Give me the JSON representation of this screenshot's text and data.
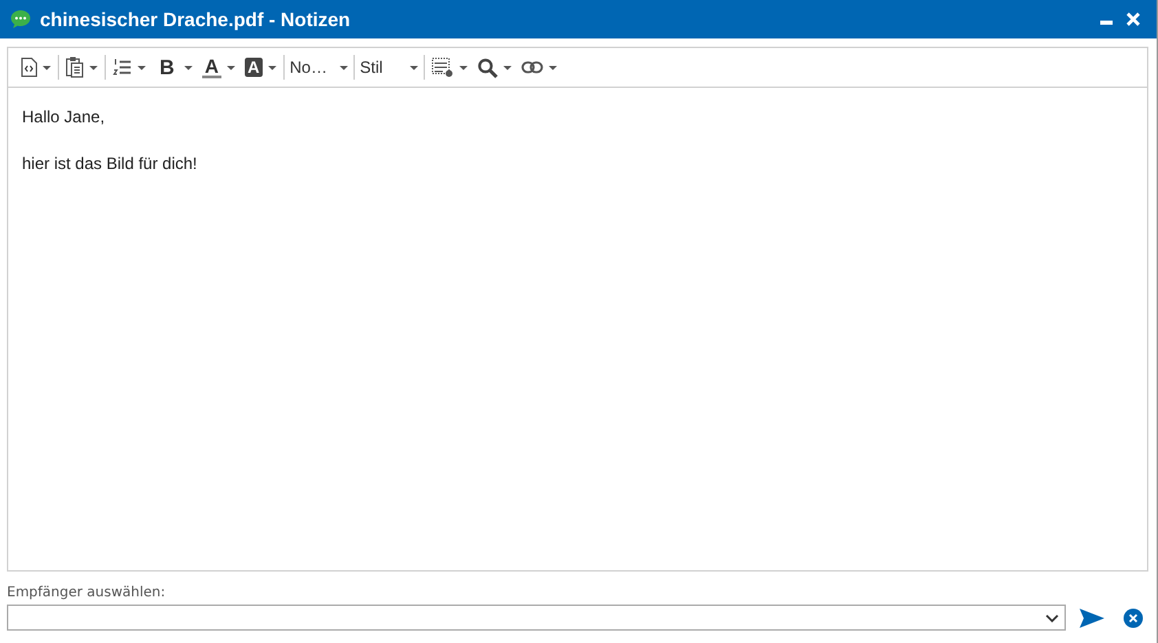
{
  "window": {
    "title": "chinesischer Drache.pdf - Notizen"
  },
  "toolbar": [
    {
      "kind": "source"
    },
    {
      "kind": "paste"
    },
    {
      "kind": "list"
    },
    {
      "kind": "bold",
      "label": "B"
    },
    {
      "kind": "color",
      "label": "A"
    },
    {
      "kind": "highlight",
      "label": "A"
    },
    {
      "kind": "combo",
      "label": "No…"
    },
    {
      "kind": "combo",
      "label": "Stil"
    },
    {
      "kind": "table"
    },
    {
      "kind": "search"
    },
    {
      "kind": "link"
    }
  ],
  "editor": {
    "paragraphs": [
      "Hallo Jane,",
      "hier ist das Bild für dich!"
    ]
  },
  "recipient": {
    "label": "Empfänger auswählen:"
  }
}
